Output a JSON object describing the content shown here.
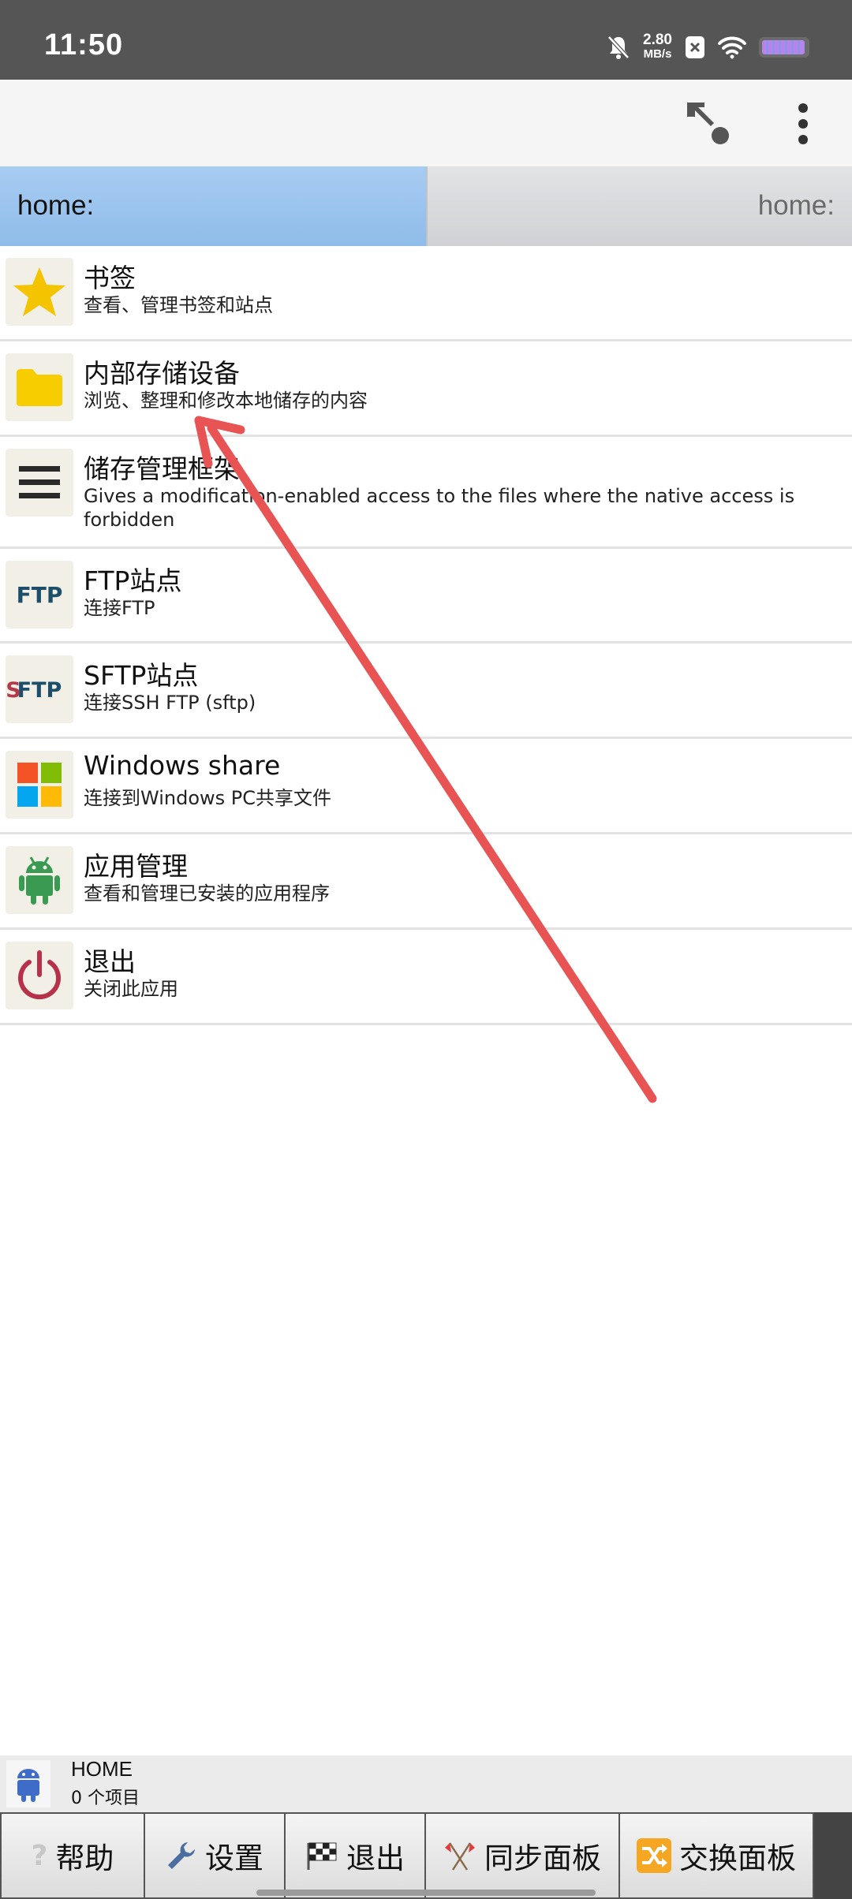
{
  "status_bar": {
    "time": "11:50",
    "net_speed_value": "2.80",
    "net_speed_unit": "MB/s",
    "icons": [
      "mute-bell-icon",
      "notification-x-icon",
      "wifi-icon",
      "battery-icon"
    ]
  },
  "toolbar": {
    "icons": [
      "sort-direction-icon",
      "more-vert-icon"
    ]
  },
  "paths": {
    "left": "home:",
    "right": "home:"
  },
  "list": [
    {
      "icon": "star-icon",
      "title": "书签",
      "subtitle": "查看、管理书签和站点"
    },
    {
      "icon": "folder-icon",
      "title": "内部存储设备",
      "subtitle": "浏览、整理和修改本地储存的内容"
    },
    {
      "icon": "menu-lines-icon",
      "title": "储存管理框架",
      "subtitle": "Gives a modification-enabled access to the files where the native access is forbidden"
    },
    {
      "icon": "ftp-icon",
      "title": "FTP站点",
      "subtitle": "连接FTP",
      "icon_text": "FTP"
    },
    {
      "icon": "sftp-icon",
      "title": "SFTP站点",
      "subtitle": "连接SSH FTP (sftp)",
      "icon_text": "SFTP"
    },
    {
      "icon": "windows-logo-icon",
      "title": "Windows share",
      "subtitle": "连接到Windows PC共享文件"
    },
    {
      "icon": "android-icon",
      "title": "应用管理",
      "subtitle": "查看和管理已安装的应用程序"
    },
    {
      "icon": "power-icon",
      "title": "退出",
      "subtitle": "关闭此应用"
    }
  ],
  "info_bar": {
    "name": "HOME",
    "count": "0 个项目"
  },
  "buttons": [
    {
      "icon": "question-icon",
      "label": "帮助"
    },
    {
      "icon": "wrench-icon",
      "label": "设置"
    },
    {
      "icon": "checkered-flag-icon",
      "label": "退出"
    },
    {
      "icon": "crossed-flags-icon",
      "label": "同步面板"
    },
    {
      "icon": "shuffle-icon",
      "label": "交换面板"
    }
  ],
  "colors": {
    "status_bar": "#555555",
    "path_active": "#9cc5ee",
    "annotation_arrow": "#e85454",
    "star": "#f5c400",
    "folder": "#f7cd00"
  }
}
